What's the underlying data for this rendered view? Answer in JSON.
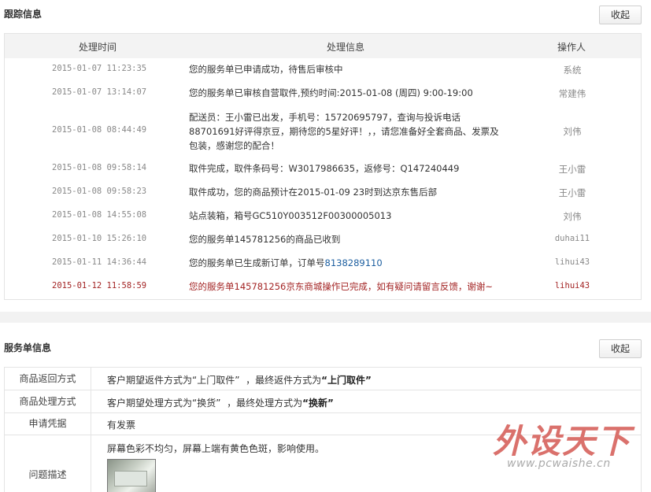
{
  "track": {
    "title": "跟踪信息",
    "fold_label": "收起",
    "headers": {
      "time": "处理时间",
      "info": "处理信息",
      "operator": "操作人"
    },
    "rows": [
      {
        "time": "2015-01-07 11:23:35",
        "info": "您的服务单已申请成功，待售后审核中",
        "operator": "系统"
      },
      {
        "time": "2015-01-07 13:14:07",
        "info": "您的服务单已审核自营取件,预约时间:2015-01-08 (周四) 9:00-19:00",
        "operator": "常建伟"
      },
      {
        "time": "2015-01-08 08:44:49",
        "info": "配送员：王小雷已出发，手机号：15720695797，查询与投诉电话88701691好评得京豆，期待您的5星好评！，，请您准备好全套商品、发票及包装，感谢您的配合！",
        "operator": "刘伟"
      },
      {
        "time": "2015-01-08 09:58:14",
        "info": "取件完成，取件条码号：W3017986635，返修号：Q147240449",
        "operator": "王小雷"
      },
      {
        "time": "2015-01-08 09:58:23",
        "info": "取件成功，您的商品预计在2015-01-09 23时到达京东售后部",
        "operator": "王小雷"
      },
      {
        "time": "2015-01-08 14:55:08",
        "info": "站点装箱，箱号GC510Y003512F00300005013",
        "operator": "刘伟"
      },
      {
        "time": "2015-01-10 15:26:10",
        "info": "您的服务单145781256的商品已收到",
        "operator": "duhai11"
      },
      {
        "time": "2015-01-11 14:36:44",
        "info_prefix": "您的服务单已生成新订单，订单号",
        "info_link": "8138289110",
        "operator": "lihui43"
      },
      {
        "time": "2015-01-12 11:58:59",
        "info": "您的服务单145781256京东商城操作已完成，如有疑问请留言反馈，谢谢~",
        "operator": "lihui43"
      }
    ]
  },
  "service": {
    "title": "服务单信息",
    "fold_label": "收起",
    "rows": {
      "return_method": {
        "label": "商品返回方式",
        "text1": "客户期望返件方式为",
        "value1": "“上门取件”",
        "text2": "，最终返件方式为",
        "value2": "“上门取件”"
      },
      "handle_method": {
        "label": "商品处理方式",
        "text1": "客户期望处理方式为",
        "value1": "“换货”",
        "text2": "，最终处理方式为",
        "value2": "“换新”"
      },
      "proof": {
        "label": "申请凭据",
        "value": "有发票"
      },
      "problem": {
        "label": "问题描述",
        "value": "屏幕色彩不均匀，屏幕上端有黄色色斑，影响使用。"
      }
    }
  },
  "watermark": {
    "title": "外设天下",
    "url": "www.pcwaishe.cn"
  },
  "colors": {
    "accent_red": "#a32424",
    "link_blue": "#1d5fa0",
    "header_bg": "#f3f3f3"
  }
}
